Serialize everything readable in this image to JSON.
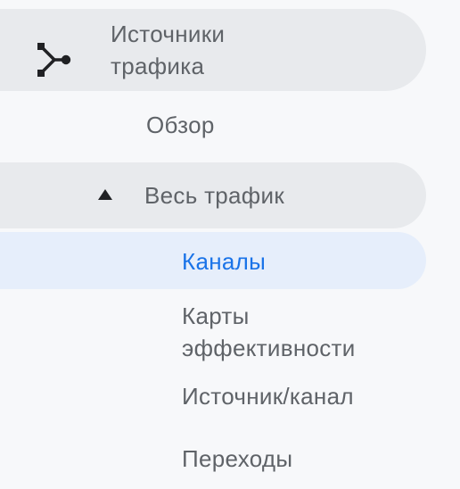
{
  "colors": {
    "background": "#f7f8fa",
    "section_pill": "#e8eaed",
    "active_pill": "#e6eefb",
    "text": "#5f6368",
    "active_text": "#1a73e8"
  },
  "nav": {
    "section": {
      "icon": "traffic-sources-icon",
      "label": "Источники трафика"
    },
    "overview": {
      "label": "Обзор"
    },
    "all_traffic": {
      "icon": "collapse-triangle-icon",
      "label": "Весь трафик",
      "expanded": true
    },
    "items": [
      {
        "label": "Каналы",
        "active": true
      },
      {
        "label": "Карты эффективности",
        "active": false
      },
      {
        "label": "Источник/канал",
        "active": false
      },
      {
        "label": "Переходы",
        "active": false
      }
    ]
  }
}
